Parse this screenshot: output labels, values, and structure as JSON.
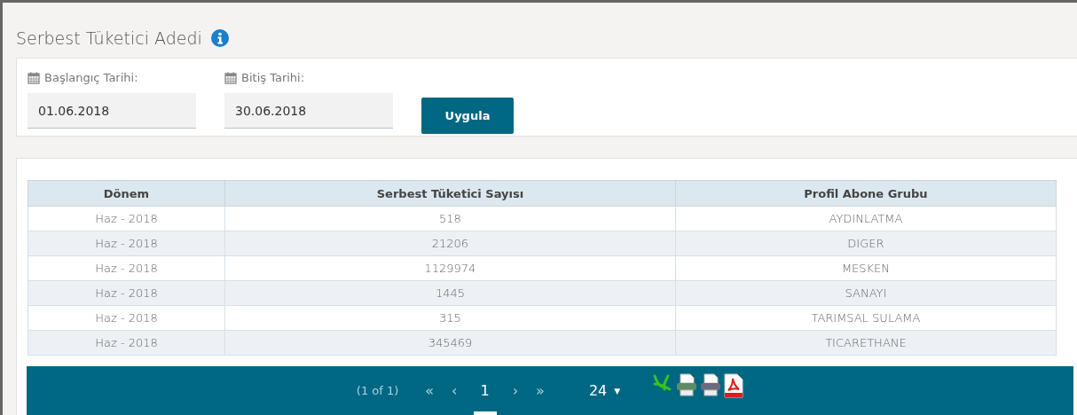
{
  "title": "Serbest Tüketici Adedi",
  "filters": [
    {
      "label": "Başlangıç Tarihi:",
      "value": "01.06.2018"
    },
    {
      "label": "Bitiş Tarihi:",
      "value": "30.06.2018"
    }
  ],
  "apply_button": "Uygula",
  "table": {
    "columns": [
      "Dönem",
      "Serbest Tüketici Sayısı",
      "Profil Abone Grubu"
    ],
    "rows": [
      [
        "Haz - 2018",
        "518",
        "AYDINLATMA"
      ],
      [
        "Haz - 2018",
        "21206",
        "DIGER"
      ],
      [
        "Haz - 2018",
        "1129974",
        "MESKEN"
      ],
      [
        "Haz - 2018",
        "1445",
        "SANAYI"
      ],
      [
        "Haz - 2018",
        "315",
        "TARIMSAL SULAMA"
      ],
      [
        "Haz - 2018",
        "345469",
        "TICARETHANE"
      ]
    ]
  },
  "paginator": {
    "summary": "(1 of 1)",
    "first": "«",
    "prev": "‹",
    "pages": [
      {
        "label": "1",
        "selected": true
      }
    ],
    "next": "›",
    "last": "»",
    "page_size": "24",
    "page_size_caret": "▼"
  }
}
